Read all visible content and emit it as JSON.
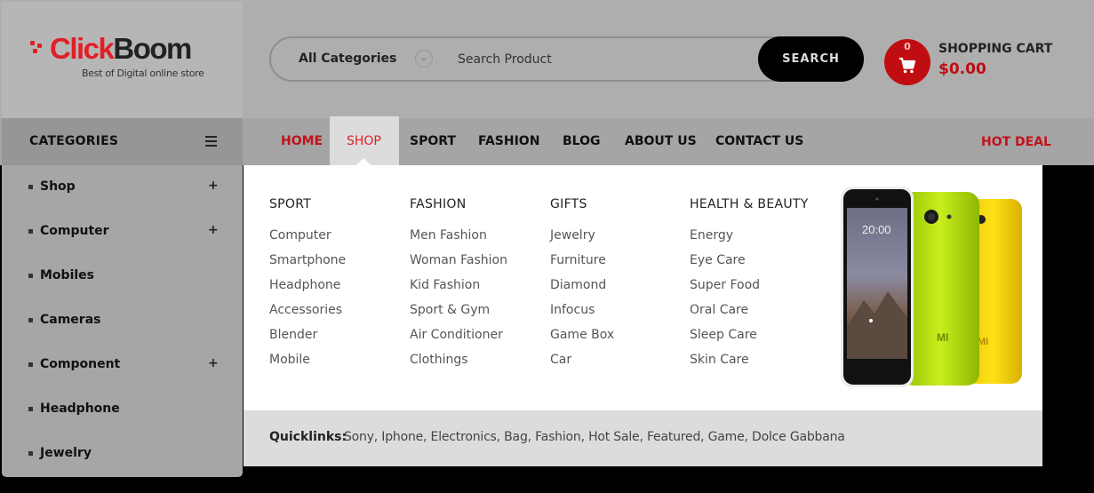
{
  "logo": {
    "brand_part1": "Click",
    "brand_part2": "Boom",
    "tagline": "Best of Digital online store"
  },
  "search": {
    "category": "All Categories",
    "placeholder": "Search Product",
    "button": "SEARCH"
  },
  "cart": {
    "count": "0",
    "title": "SHOPPING CART",
    "total": "$0.00"
  },
  "categories": {
    "heading": "CATEGORIES",
    "items": [
      {
        "label": "Shop",
        "expand": "+"
      },
      {
        "label": "Computer",
        "expand": "+"
      },
      {
        "label": "Mobiles",
        "expand": ""
      },
      {
        "label": "Cameras",
        "expand": ""
      },
      {
        "label": "Component",
        "expand": "+"
      },
      {
        "label": "Headphone",
        "expand": ""
      },
      {
        "label": "Jewelry",
        "expand": ""
      }
    ]
  },
  "nav": {
    "items": [
      "HOME",
      "SHOP",
      "SPORT",
      "FASHION",
      "BLOG",
      "ABOUT US",
      "CONTACT US"
    ],
    "hot_deal": "HOT DEAL",
    "active": "SHOP"
  },
  "mega_menu": {
    "columns": [
      {
        "title": "SPORT",
        "links": [
          "Computer",
          "Smartphone",
          "Headphone",
          "Accessories",
          "Blender",
          "Mobile"
        ]
      },
      {
        "title": "FASHION",
        "links": [
          "Men Fashion",
          "Woman Fashion",
          "Kid Fashion",
          "Sport & Gym",
          "Air Conditioner",
          "Clothings"
        ]
      },
      {
        "title": "GIFTS",
        "links": [
          "Jewelry",
          "Furniture",
          "Diamond",
          "Infocus",
          "Game Box",
          "Car"
        ]
      },
      {
        "title": "HEALTH & BEAUTY",
        "links": [
          "Energy",
          "Eye Care",
          "Super Food",
          "Oral Care",
          "Sleep Care",
          "Skin Care"
        ]
      }
    ],
    "promo_image": {
      "phone_time": "20:00",
      "phone_brand": "MI"
    },
    "quicklinks": {
      "label": "Quicklinks:",
      "links": "Sony, Iphone, Electronics, Bag, Fashion, Hot Sale, Featured, Game, Dolce Gabbana"
    }
  },
  "colors": {
    "accent": "#e01f26",
    "cart_red": "#c00d12",
    "nav_active": "#e01f26"
  },
  "icons": {
    "menu": "hamburger-icon",
    "cart": "shopping-cart-icon",
    "chevron": "chevron-down-icon"
  }
}
